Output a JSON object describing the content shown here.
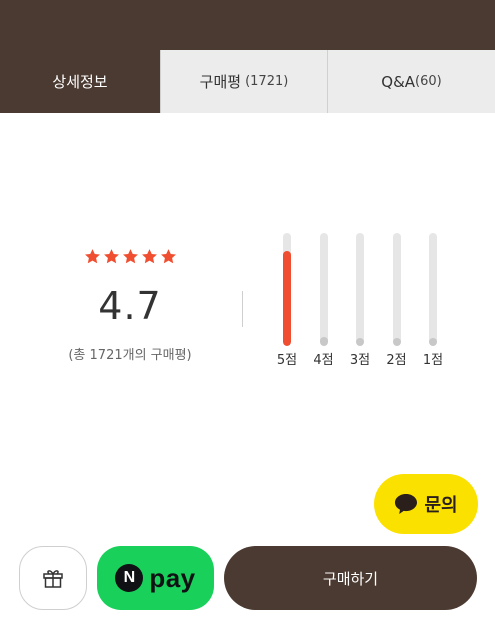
{
  "tabs": [
    {
      "label": "상세정보",
      "active": true
    },
    {
      "label": "구매평",
      "count": "(1721)",
      "active": false
    },
    {
      "label": "Q&A",
      "count": "(60)",
      "active": false
    }
  ],
  "rating": {
    "stars": 5,
    "score": "4.7",
    "total_text": "(총 1721개의 구매평)"
  },
  "distribution": [
    {
      "label": "5점",
      "fraction": 0.84
    },
    {
      "label": "4점",
      "fraction": 0.08
    },
    {
      "label": "3점",
      "fraction": 0.03
    },
    {
      "label": "2점",
      "fraction": 0.0
    },
    {
      "label": "1점",
      "fraction": 0.0
    }
  ],
  "floating": {
    "inquiry_label": "문의"
  },
  "bottom": {
    "npay_letter": "N",
    "npay_text": "pay",
    "buy_label": "구매하기"
  },
  "colors": {
    "brand_brown": "#4b3a31",
    "star_red": "#f04e30",
    "kakao_yellow": "#fbe100",
    "npay_green": "#19d05a"
  }
}
